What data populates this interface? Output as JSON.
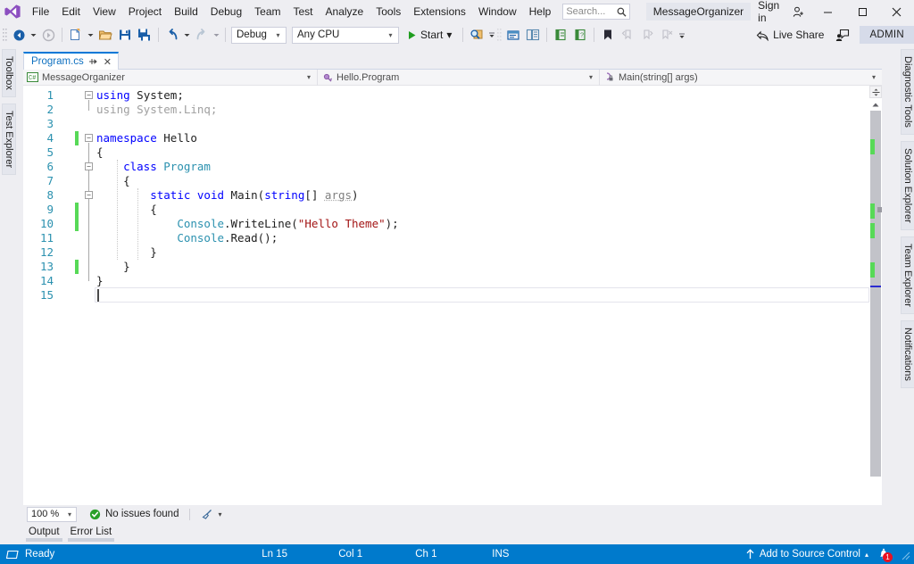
{
  "window": {
    "project_name": "MessageOrganizer",
    "sign_in_label": "Sign in",
    "minimize_label": "─",
    "maximize_label": "□",
    "close_label": "✕"
  },
  "menubar": {
    "items": [
      {
        "label": "File"
      },
      {
        "label": "Edit"
      },
      {
        "label": "View"
      },
      {
        "label": "Project"
      },
      {
        "label": "Build"
      },
      {
        "label": "Debug"
      },
      {
        "label": "Team"
      },
      {
        "label": "Test"
      },
      {
        "label": "Analyze"
      },
      {
        "label": "Tools"
      },
      {
        "label": "Extensions"
      },
      {
        "label": "Window"
      },
      {
        "label": "Help"
      }
    ],
    "search_placeholder": "Search..."
  },
  "toolbar": {
    "configuration": "Debug",
    "platform": "Any CPU",
    "start_label": "Start",
    "live_share_label": "Live Share",
    "admin_label": "ADMIN",
    "dropdown_arrow": "▾"
  },
  "left_dock": {
    "items": [
      {
        "label": "Toolbox"
      },
      {
        "label": "Test Explorer"
      }
    ]
  },
  "right_dock": {
    "items": [
      {
        "label": "Diagnostic Tools"
      },
      {
        "label": "Solution Explorer"
      },
      {
        "label": "Team Explorer"
      },
      {
        "label": "Notifications"
      }
    ]
  },
  "document_tab": {
    "title": "Program.cs",
    "pin_glyph": "▭",
    "close_glyph": "✕"
  },
  "navigation_bar": {
    "project": "MessageOrganizer",
    "type": "Hello.Program",
    "member": "Main(string[] args)",
    "arrow": "▾"
  },
  "editor": {
    "line_numbers": [
      "1",
      "2",
      "3",
      "4",
      "5",
      "6",
      "7",
      "8",
      "9",
      "10",
      "11",
      "12",
      "13",
      "14",
      "15"
    ],
    "lines": [
      {
        "n": 1,
        "text": "using System;"
      },
      {
        "n": 2,
        "text": "using System.Linq;"
      },
      {
        "n": 3,
        "text": ""
      },
      {
        "n": 4,
        "text": "namespace Hello"
      },
      {
        "n": 5,
        "text": "{"
      },
      {
        "n": 6,
        "text": "    class Program"
      },
      {
        "n": 7,
        "text": "    {"
      },
      {
        "n": 8,
        "text": "        static void Main(string[] args)"
      },
      {
        "n": 9,
        "text": "        {"
      },
      {
        "n": 10,
        "text": "            Console.WriteLine(\"Hello Theme\");"
      },
      {
        "n": 11,
        "text": "            Console.Read();"
      },
      {
        "n": 12,
        "text": "        }"
      },
      {
        "n": 13,
        "text": "    }"
      },
      {
        "n": 14,
        "text": "}"
      },
      {
        "n": 15,
        "text": ""
      }
    ],
    "collapse_glyph": "−"
  },
  "editor_status": {
    "zoom_level": "100 %",
    "zoom_arrow": "▾",
    "issues_text": "No issues found",
    "filter_arrow": "▾"
  },
  "bottom_tabs": {
    "items": [
      {
        "label": "Output"
      },
      {
        "label": "Error List"
      }
    ]
  },
  "statusbar": {
    "status": "Ready",
    "line": "Ln 15",
    "column": "Col 1",
    "character": "Ch 1",
    "insert_mode": "INS",
    "source_control": "Add to Source Control",
    "source_control_arrow": "▴",
    "notification_count": "1"
  },
  "colors": {
    "accent_blue": "#007acc",
    "tab_active_border": "#0078d7",
    "chrome_bg": "#eeeef2",
    "editor_bg": "#ffffff",
    "keyword": "#0000ff",
    "type": "#2b91af",
    "string": "#a31515",
    "line_number": "#2b91af",
    "unused_using": "#a0a0a0",
    "change_bar": "#57d957",
    "error_badge": "#e81123"
  }
}
